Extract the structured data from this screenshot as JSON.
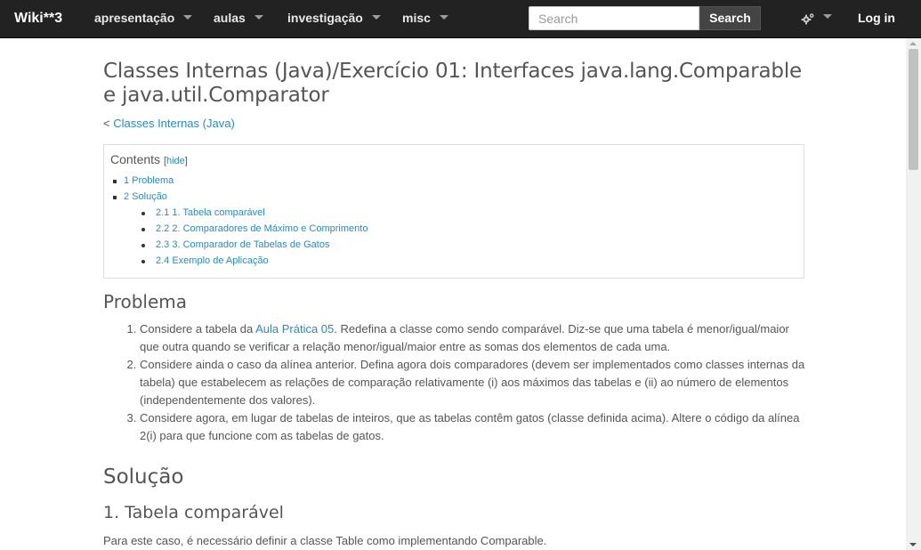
{
  "navbar": {
    "brand": "Wiki**3",
    "items": [
      {
        "label": "apresentação"
      },
      {
        "label": "aulas"
      },
      {
        "label": "investigação"
      },
      {
        "label": "misc"
      }
    ],
    "search": {
      "placeholder": "Search",
      "button_label": "Search"
    },
    "login_label": "Log in"
  },
  "page": {
    "title": "Classes Internas (Java)/Exercício 01: Interfaces java.lang.Comparable e java.util.Comparator",
    "back_prefix": "< ",
    "back_link": "Classes Internas (Java)"
  },
  "toc": {
    "title": "Contents",
    "hide_open": "[",
    "hide_label": "hide",
    "hide_close": "]",
    "items": [
      {
        "label": "1 Problema"
      },
      {
        "label": "2 Solução"
      }
    ],
    "subitems": [
      {
        "label": "2.1 1. Tabela comparável"
      },
      {
        "label": "2.2 2. Comparadores de Máximo e Comprimento"
      },
      {
        "label": "2.3 3. Comparador de Tabelas de Gatos"
      },
      {
        "label": "2.4 Exemplo de Aplicação"
      }
    ]
  },
  "problema": {
    "heading": "Problema",
    "item1_pre": "Considere a tabela da ",
    "item1_link": "Aula Prática 05",
    "item1_post": ". Redefina a classe como sendo comparável. Diz-se que uma tabela é menor/igual/maior que outra quando se verificar a relação menor/igual/maior entre as somas dos elementos de cada uma.",
    "item2": "Considere ainda o caso da alínea anterior. Defina agora dois comparadores (devem ser implementados como classes internas da tabela) que estabelecem as relações de comparação relativamente (i) aos máximos das tabelas e (ii) ao número de elementos (independentemente dos valores).",
    "item3": "Considere agora, em lugar de tabelas de inteiros, que as tabelas contêm gatos (classe definida acima). Altere o código da alínea 2(i) para que funcione com as tabelas de gatos."
  },
  "solucao": {
    "heading": "Solução",
    "sub1_heading": "1. Tabela comparável",
    "sub1_text": "Para este caso, é necessário definir a classe Table como implementando Comparable."
  }
}
